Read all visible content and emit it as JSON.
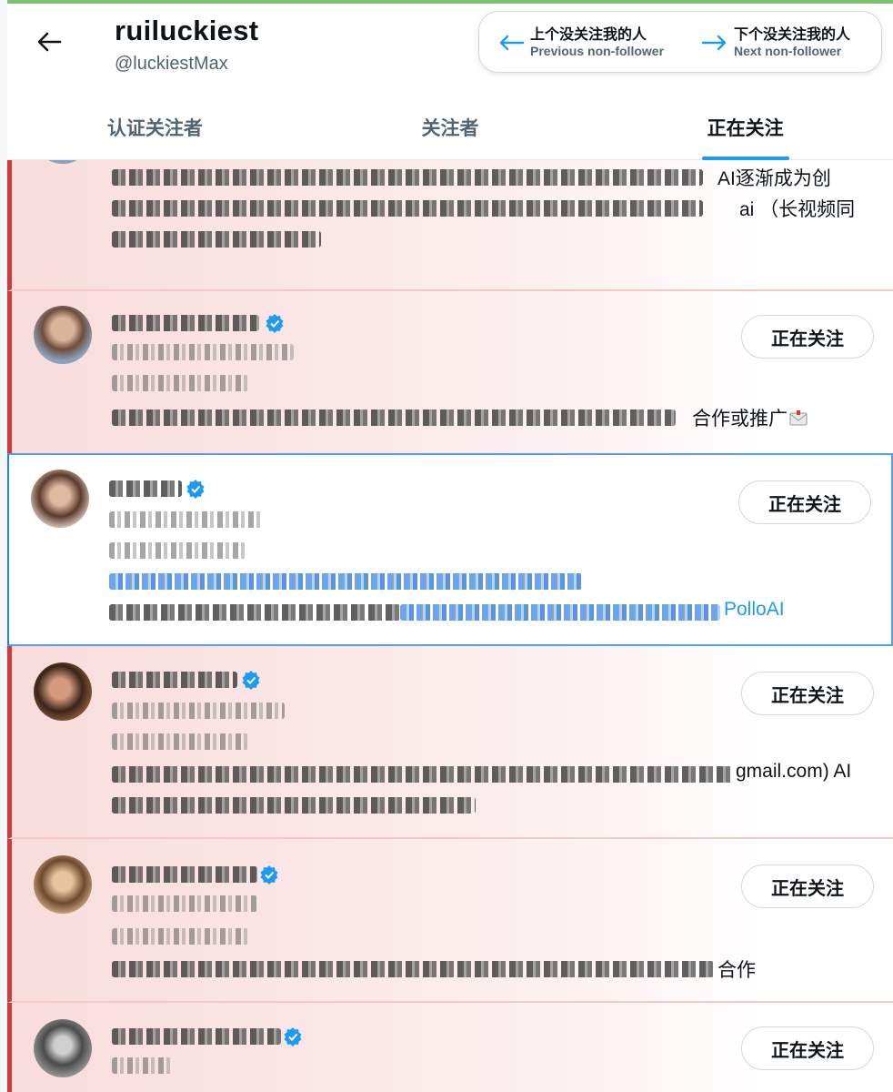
{
  "header": {
    "title": "ruiluckiest",
    "handle": "@luckiestMax",
    "prev": {
      "zh": "上个没关注我的人",
      "en": "Previous non-follower"
    },
    "next": {
      "zh": "下个没关注我的人",
      "en": "Next non-follower"
    }
  },
  "tabs": [
    {
      "label": "认证关注者",
      "active": false
    },
    {
      "label": "关注者",
      "active": false
    },
    {
      "label": "正在关注",
      "active": true
    }
  ],
  "colors": {
    "accent": "#1d9bf0",
    "non_follower_border": "#cf3a3a",
    "highlight_border": "#5a9ee0",
    "verified": "#1d9bf0"
  },
  "feed": {
    "users": [
      {
        "bio_line1_visible": "AI逐渐成为创",
        "bio_line2_visible": "ai （长视频同"
      },
      {
        "button": "正在关注",
        "bio_visible": "合作或推广"
      },
      {
        "button": "正在关注",
        "bio_link_visible": "PolloAI"
      },
      {
        "button": "正在关注",
        "bio_line1_visible": "gmail.com) AI"
      },
      {
        "button": "正在关注",
        "bio_visible": "合作"
      },
      {
        "button": "正在关注"
      }
    ]
  }
}
